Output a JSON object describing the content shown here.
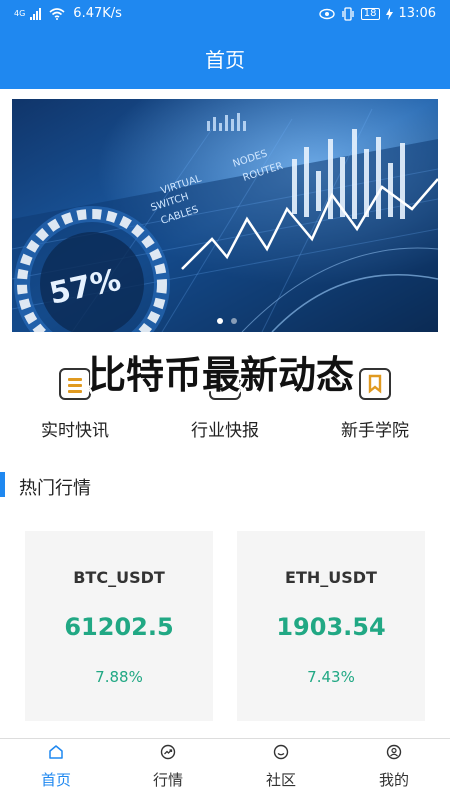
{
  "status_bar": {
    "network_type": "4G",
    "speed": "6.47K/s",
    "battery": "18",
    "time": "13:06"
  },
  "header": {
    "title": "首页"
  },
  "banner": {
    "image_texts": [
      "VIRTUAL",
      "SWITCH",
      "CABLES",
      "NODES",
      "ROUTER",
      "57%"
    ],
    "dots": 2,
    "active_dot": 1
  },
  "overlay": {
    "headline": "比特币最新动态"
  },
  "quick_nav": [
    {
      "label": "实时快讯",
      "icon": "news-list-icon"
    },
    {
      "label": "行业快报",
      "icon": "report-icon"
    },
    {
      "label": "新手学院",
      "icon": "bookmark-icon"
    }
  ],
  "section": {
    "title": "热门行情"
  },
  "tickers": [
    {
      "pair": "BTC_USDT",
      "price": "61202.5",
      "change": "7.88%"
    },
    {
      "pair": "ETH_USDT",
      "price": "1903.54",
      "change": "7.43%"
    }
  ],
  "tabs": [
    {
      "label": "首页",
      "icon": "home-icon",
      "active": true
    },
    {
      "label": "行情",
      "icon": "trend-icon",
      "active": false
    },
    {
      "label": "社区",
      "icon": "smile-icon",
      "active": false
    },
    {
      "label": "我的",
      "icon": "user-icon",
      "active": false
    }
  ],
  "colors": {
    "primary": "#1f88f0",
    "up": "#21a884",
    "card_bg": "#f5f5f5"
  }
}
